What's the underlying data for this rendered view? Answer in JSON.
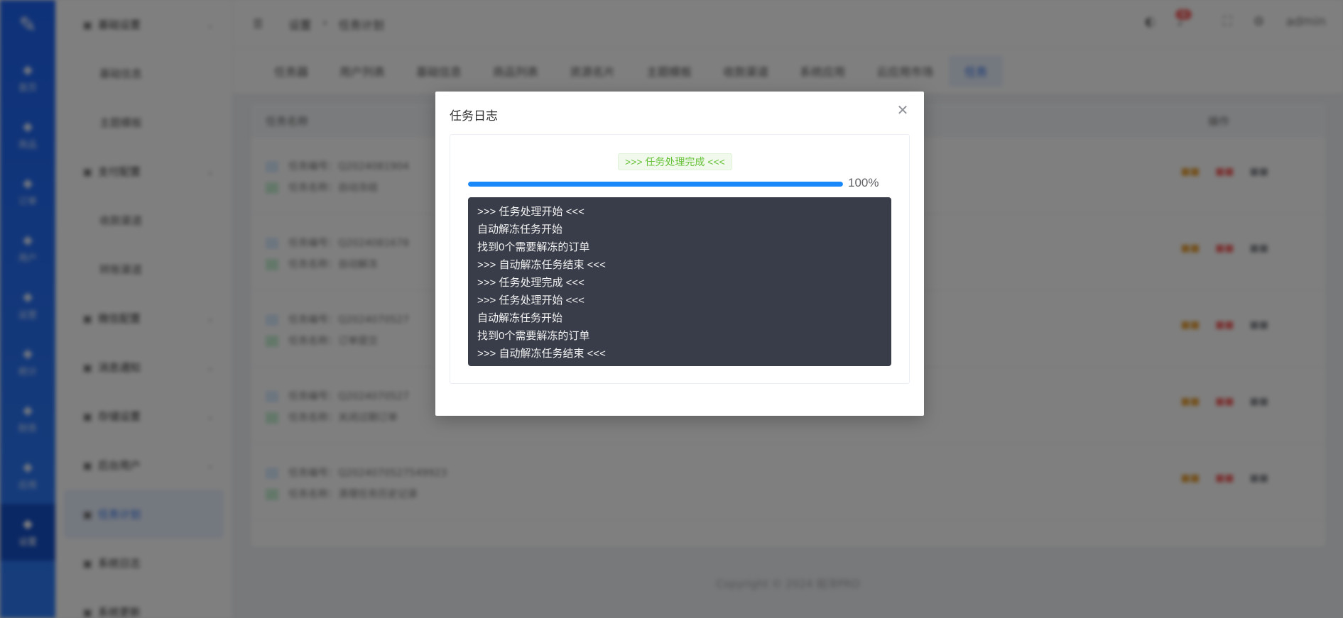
{
  "app": {
    "rail_items": [
      "首页",
      "商品",
      "订单",
      "用户",
      "运营",
      "统计",
      "财务",
      "应用",
      "设置"
    ],
    "sidebar": [
      {
        "label": "基础设置",
        "type": "group"
      },
      {
        "label": "基础信息",
        "type": "sub"
      },
      {
        "label": "主题模板",
        "type": "sub"
      },
      {
        "label": "支付配置",
        "type": "group"
      },
      {
        "label": "收款渠道",
        "type": "sub"
      },
      {
        "label": "转账渠道",
        "type": "sub"
      },
      {
        "label": "微信配置",
        "type": "group"
      },
      {
        "label": "消息通知",
        "type": "group"
      },
      {
        "label": "存储设置",
        "type": "group"
      },
      {
        "label": "后台用户",
        "type": "group"
      },
      {
        "label": "任务计划",
        "type": "active"
      },
      {
        "label": "系统日志",
        "type": "item"
      },
      {
        "label": "系统更新",
        "type": "item"
      }
    ],
    "breadcrumb": [
      "设置",
      "任务计划"
    ],
    "user": "admin",
    "tabs": [
      "任务器",
      "用户列表",
      "基础信息",
      "商品列表",
      "资源名片",
      "主题模板",
      "收款渠道",
      "系统应用",
      "云应用市场",
      "任务"
    ],
    "table_header": {
      "name": "任务名称",
      "ops": "操作"
    },
    "rows": [
      {
        "id": "任务编号：Q2024081904",
        "name": "任务名称：自动冻结"
      },
      {
        "id": "任务编号：Q2024081678",
        "name": "任务名称：自动解冻"
      },
      {
        "id": "任务编号：Q2024070527",
        "name": "任务名称：订单提交"
      },
      {
        "id": "任务编号：Q2024070527",
        "name": "任务名称：关闭过期订单"
      },
      {
        "id": "任务编号：Q2024070527549923",
        "name": "任务名称：清理任务历史记录"
      }
    ],
    "copyright": "Copyright © 2024 祖洋PRO"
  },
  "dialog": {
    "title": "任务日志",
    "status": ">>> 任务处理完成 <<<",
    "progress_percent": 100,
    "progress_label": "100%",
    "log_lines": [
      ">>> 任务处理开始 <<<",
      "自动解冻任务开始",
      "找到0个需要解冻的订单",
      ">>> 自动解冻任务结束 <<<",
      ">>> 任务处理完成 <<<",
      ">>> 任务处理开始 <<<",
      "自动解冻任务开始",
      "找到0个需要解冻的订单",
      ">>> 自动解冻任务结束 <<<"
    ]
  },
  "colors": {
    "accent": "#1989fa",
    "log_bg": "#393d49",
    "success": "#67c23a",
    "rail": "#1d63f2"
  }
}
